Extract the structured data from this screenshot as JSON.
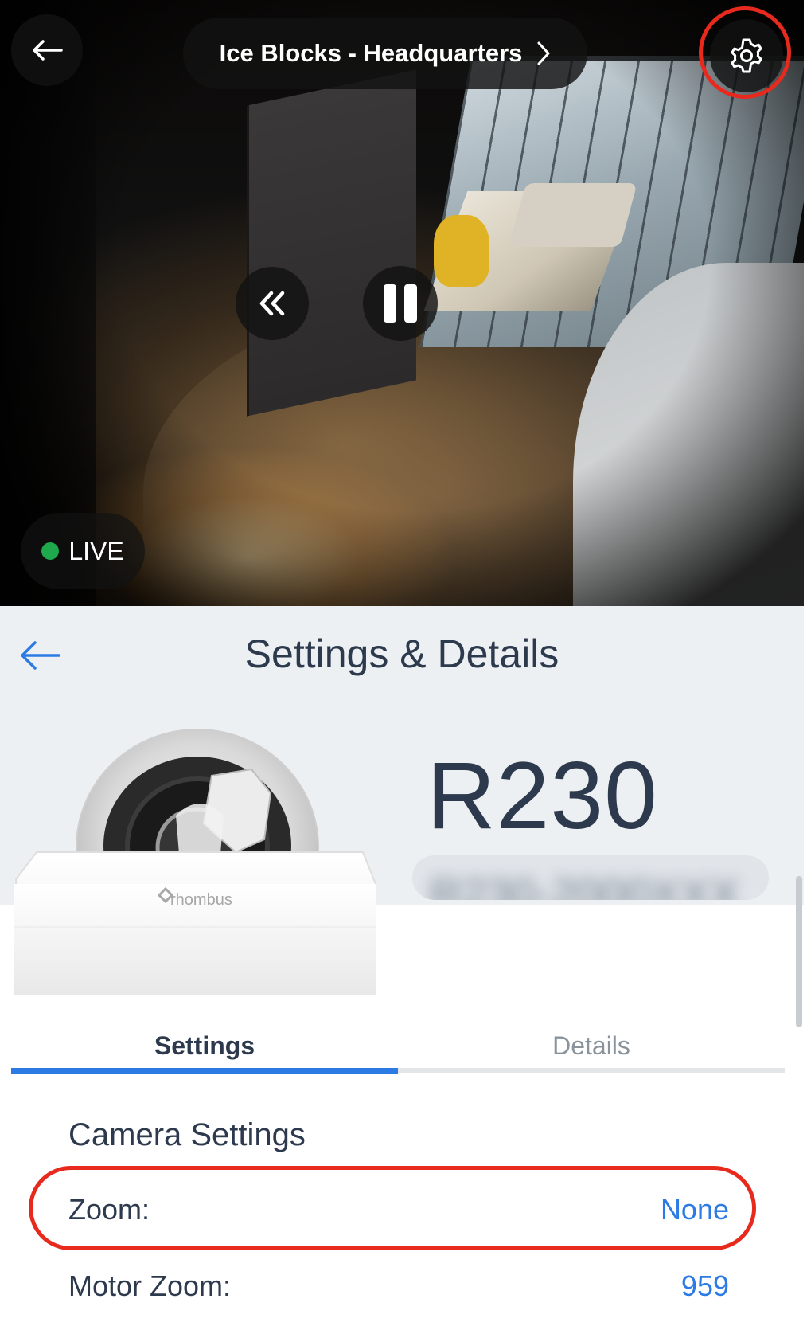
{
  "video": {
    "title": "Ice Blocks - Headquarters",
    "live_label": "LIVE",
    "icons": {
      "back": "arrow-left-icon",
      "title_chevron": "chevron-right-icon",
      "settings": "gear-icon",
      "rewind": "double-chevron-left-icon",
      "pause": "pause-icon"
    }
  },
  "panel": {
    "title": "Settings & Details",
    "model": "R230",
    "serial": "R230-2000XXX"
  },
  "camera_image_brand": "rhombus",
  "tabs": [
    {
      "label": "Settings",
      "active": true
    },
    {
      "label": "Details",
      "active": false
    }
  ],
  "camera_settings": {
    "title": "Camera Settings",
    "rows": [
      {
        "label": "Zoom:",
        "value": "None"
      },
      {
        "label": "Motor Zoom:",
        "value": "959"
      }
    ]
  },
  "colors": {
    "accent": "#2c7be5",
    "highlight": "#e8291d",
    "live": "#1ea94d",
    "text_dark": "#2d3a4d",
    "panel_bg": "#edf0f3"
  }
}
